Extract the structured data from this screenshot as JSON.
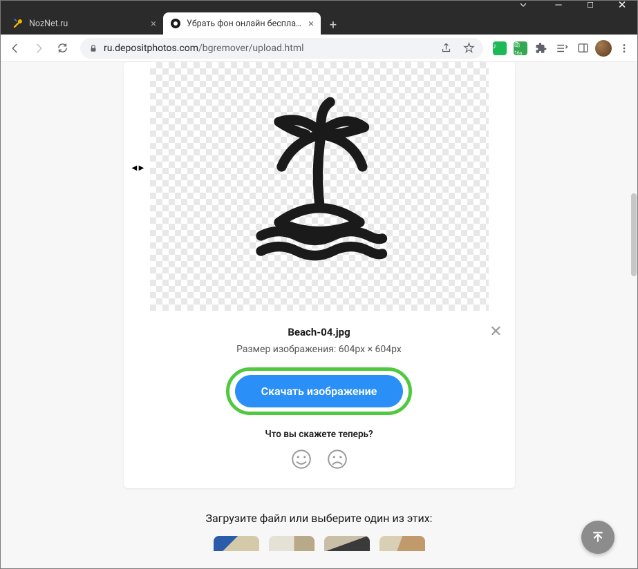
{
  "window": {
    "minimize": "–",
    "maximize": "□",
    "close": "×"
  },
  "tabs": [
    {
      "title": "NozNet.ru",
      "active": false
    },
    {
      "title": "Убрать фон онлайн бесплатно ×",
      "active": true
    }
  ],
  "toolbar": {
    "url_host": "ru.depositphotos.com",
    "url_path": "/bgremover/upload.html"
  },
  "card": {
    "filename": "Beach-04.jpg",
    "dimensions": "Размер изображения: 604px × 604px",
    "download_label": "Скачать изображение",
    "feedback_question": "Что вы скажете теперь?"
  },
  "upload": {
    "prompt": "Загрузите файл или выберите один из этих:"
  }
}
